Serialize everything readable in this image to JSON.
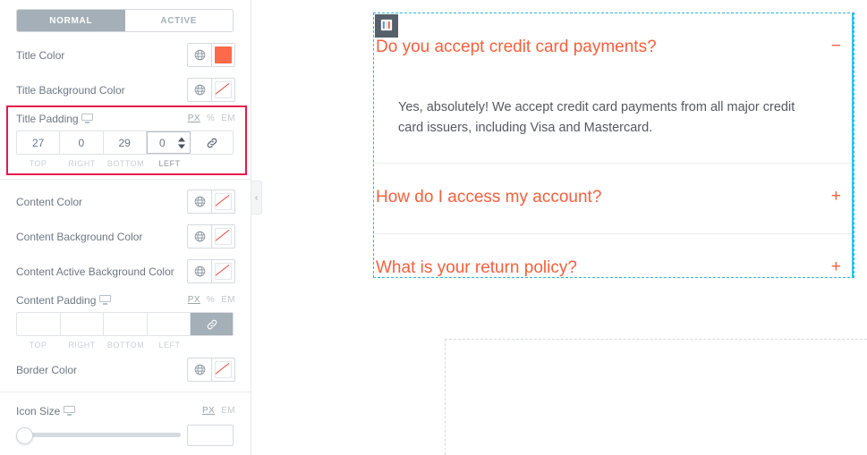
{
  "panel": {
    "tabs": [
      {
        "label": "NORMAL",
        "active": true
      },
      {
        "label": "ACTIVE",
        "active": false
      }
    ],
    "controls": {
      "title_color": {
        "label": "Title Color",
        "globe_icon": "globe-icon",
        "swatch_color": "#FF6A4A",
        "swatch_empty": false
      },
      "title_background_color": {
        "label": "Title Background Color",
        "globe_icon": "globe-icon",
        "swatch_color": "",
        "swatch_empty": true
      },
      "title_padding": {
        "label": "Title Padding",
        "device_icon": "desktop-icon",
        "units": [
          "PX",
          "%",
          "EM"
        ],
        "active_unit": "PX",
        "values": {
          "top": "27",
          "right": "0",
          "bottom": "29",
          "left": "0"
        },
        "labels": {
          "top": "TOP",
          "right": "RIGHT",
          "bottom": "BOTTOM",
          "left": "LEFT"
        },
        "focused_field": "left",
        "link_icon": "link-icon",
        "link_active": false
      },
      "content_color": {
        "label": "Content Color",
        "globe_icon": "globe-icon",
        "swatch_color": "",
        "swatch_empty": true
      },
      "content_background_color": {
        "label": "Content Background Color",
        "globe_icon": "globe-icon",
        "swatch_color": "",
        "swatch_empty": true
      },
      "content_active_background_color": {
        "label": "Content Active Background Color",
        "globe_icon": "globe-icon",
        "swatch_color": "",
        "swatch_empty": true
      },
      "content_padding": {
        "label": "Content Padding",
        "device_icon": "desktop-icon",
        "units": [
          "PX",
          "%",
          "EM"
        ],
        "active_unit": "PX",
        "values": {
          "top": "",
          "right": "",
          "bottom": "",
          "left": ""
        },
        "labels": {
          "top": "TOP",
          "right": "RIGHT",
          "bottom": "BOTTOM",
          "left": "LEFT"
        },
        "focused_field": "",
        "link_icon": "link-icon",
        "link_active": true
      },
      "border_color": {
        "label": "Border Color",
        "globe_icon": "globe-icon",
        "swatch_color": "",
        "swatch_empty": true
      },
      "icon_size": {
        "label": "Icon Size",
        "device_icon": "desktop-icon",
        "units": [
          "PX",
          "EM"
        ],
        "active_unit": "PX",
        "value": "",
        "slider_position_pct": 0
      }
    },
    "collapse_handle_icon": "chevron-left-icon",
    "highlight_color": "#E8174A"
  },
  "canvas": {
    "widget": {
      "handle_icon": "accordion-widget-icon",
      "selection_color": "#29C5E8",
      "accent_color": "#F4603E",
      "items": [
        {
          "title": "Do you accept credit card payments?",
          "toggle": "−",
          "expanded": true,
          "body": "Yes, absolutely! We accept credit card payments from all major credit card issuers, including Visa and Mastercard."
        },
        {
          "title": "How do I access my account?",
          "toggle": "+",
          "expanded": false,
          "body": ""
        },
        {
          "title": "What is your return policy?",
          "toggle": "+",
          "expanded": false,
          "body": ""
        }
      ]
    },
    "drop_section": {
      "name": "empty-section-dropzone"
    }
  }
}
